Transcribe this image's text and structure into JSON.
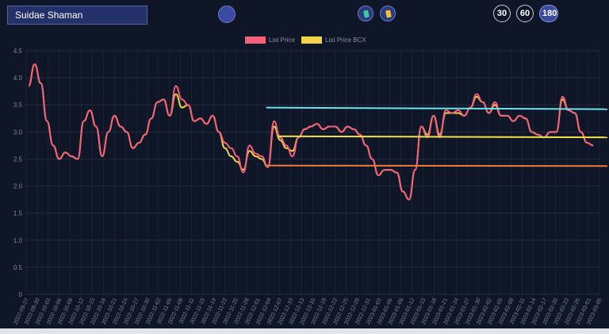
{
  "header": {
    "title": "Suidae Shaman",
    "center_button_icon": "circle-icon",
    "icon_buttons": [
      {
        "name": "green-card-icon",
        "color": "#3cc8a0"
      },
      {
        "name": "yellow-card-icon",
        "color": "#f5c033"
      }
    ],
    "range_buttons": [
      "30",
      "60",
      "180"
    ],
    "active_range": "180"
  },
  "chart_data": {
    "type": "line",
    "legend": [
      {
        "name": "List Price",
        "color": "#f7607a"
      },
      {
        "name": "List Price BCX",
        "color": "#f2d24a"
      }
    ],
    "yticks": [
      "0",
      "0.5",
      "1.0",
      "1.5",
      "2.0",
      "2.5",
      "3.0",
      "3.5",
      "4.0",
      "4.5"
    ],
    "ylim": [
      0,
      4.5
    ],
    "xticks": [
      "2022-09-27",
      "2022-09-30",
      "2022-10-03",
      "2022-10-06",
      "2022-10-09",
      "2022-10-12",
      "2022-10-15",
      "2022-10-18",
      "2022-10-21",
      "2022-10-24",
      "2022-10-27",
      "2022-10-30",
      "2022-11-02",
      "2022-11-05",
      "2022-11-08",
      "2022-11-11",
      "2022-11-15",
      "2022-11-19",
      "2022-11-22",
      "2022-11-25",
      "2022-11-28",
      "2022-12-01",
      "2022-12-04",
      "2022-12-07",
      "2022-12-10",
      "2022-12-13",
      "2022-12-16",
      "2022-12-19",
      "2022-12-22",
      "2022-12-25",
      "2022-12-28",
      "2022-12-31",
      "2023-01-03",
      "2023-01-06",
      "2023-01-09",
      "2023-01-12",
      "2023-01-15",
      "2023-01-18",
      "2023-01-21",
      "2023-01-24",
      "2023-01-27",
      "2023-01-30",
      "2023-02-02",
      "2023-02-05",
      "2023-02-08",
      "2023-02-11",
      "2023-02-14",
      "2023-02-17",
      "2023-02-20",
      "2023-02-23",
      "2023-02-26",
      "2023-03-01",
      "2023-03-05"
    ],
    "series": [
      {
        "name": "List Price",
        "color": "#f7607a",
        "values": [
          3.85,
          4.25,
          3.9,
          3.2,
          2.75,
          2.5,
          2.62,
          2.55,
          2.5,
          3.2,
          3.4,
          3.1,
          2.55,
          3.0,
          3.3,
          3.1,
          3.0,
          2.7,
          2.8,
          2.95,
          3.25,
          3.55,
          3.6,
          3.3,
          3.85,
          3.6,
          3.5,
          3.2,
          3.25,
          3.15,
          3.3,
          3.0,
          2.8,
          2.7,
          2.55,
          2.25,
          2.75,
          2.6,
          2.55,
          2.35,
          3.2,
          2.9,
          2.75,
          2.55,
          2.9,
          3.05,
          3.1,
          3.15,
          3.05,
          3.1,
          3.1,
          3.0,
          3.1,
          3.05,
          2.95,
          2.75,
          2.5,
          2.2,
          2.3,
          2.3,
          2.25,
          1.9,
          1.75,
          2.3,
          3.1,
          2.9,
          3.3,
          2.9,
          3.4,
          3.35,
          3.4,
          3.3,
          3.45,
          3.7,
          3.55,
          3.35,
          3.55,
          3.3,
          3.3,
          3.2,
          3.3,
          3.25,
          3.0,
          2.95,
          2.9,
          3.0,
          3.0,
          3.65,
          3.4,
          3.35,
          3.0,
          2.8,
          2.75
        ]
      },
      {
        "name": "List Price BCX",
        "color": "#f2d24a",
        "values": [
          3.85,
          4.25,
          3.9,
          3.2,
          2.75,
          2.5,
          2.62,
          2.55,
          2.5,
          3.2,
          3.4,
          3.1,
          2.55,
          3.0,
          3.3,
          3.1,
          3.0,
          2.7,
          2.8,
          2.95,
          3.25,
          3.55,
          3.6,
          3.3,
          3.7,
          3.45,
          3.5,
          3.2,
          3.25,
          3.15,
          3.3,
          3.0,
          2.7,
          2.55,
          2.45,
          2.3,
          2.65,
          2.55,
          2.5,
          2.35,
          3.1,
          2.85,
          2.7,
          2.65,
          2.9,
          3.05,
          3.1,
          3.15,
          3.05,
          3.1,
          3.1,
          3.0,
          3.1,
          3.05,
          2.95,
          2.75,
          2.5,
          2.2,
          2.3,
          2.3,
          2.25,
          1.9,
          1.75,
          2.3,
          3.1,
          2.95,
          3.3,
          2.95,
          3.35,
          3.35,
          3.35,
          3.3,
          3.45,
          3.65,
          3.55,
          3.35,
          3.5,
          3.3,
          3.3,
          3.2,
          3.3,
          3.25,
          3.0,
          2.95,
          2.9,
          3.0,
          3.0,
          3.6,
          3.4,
          3.35,
          3.0,
          2.8,
          2.75
        ]
      }
    ],
    "reference_lines": [
      {
        "color": "#6fe3ea",
        "y_start": 3.45,
        "y_end": 3.42,
        "from_index": 40
      },
      {
        "color": "#f2e14a",
        "y_start": 2.92,
        "y_end": 2.9,
        "from_index": 42
      },
      {
        "color": "#f07a3a",
        "y_start": 2.38,
        "y_end": 2.37,
        "from_index": 40
      }
    ],
    "grid": true
  },
  "footer": {}
}
